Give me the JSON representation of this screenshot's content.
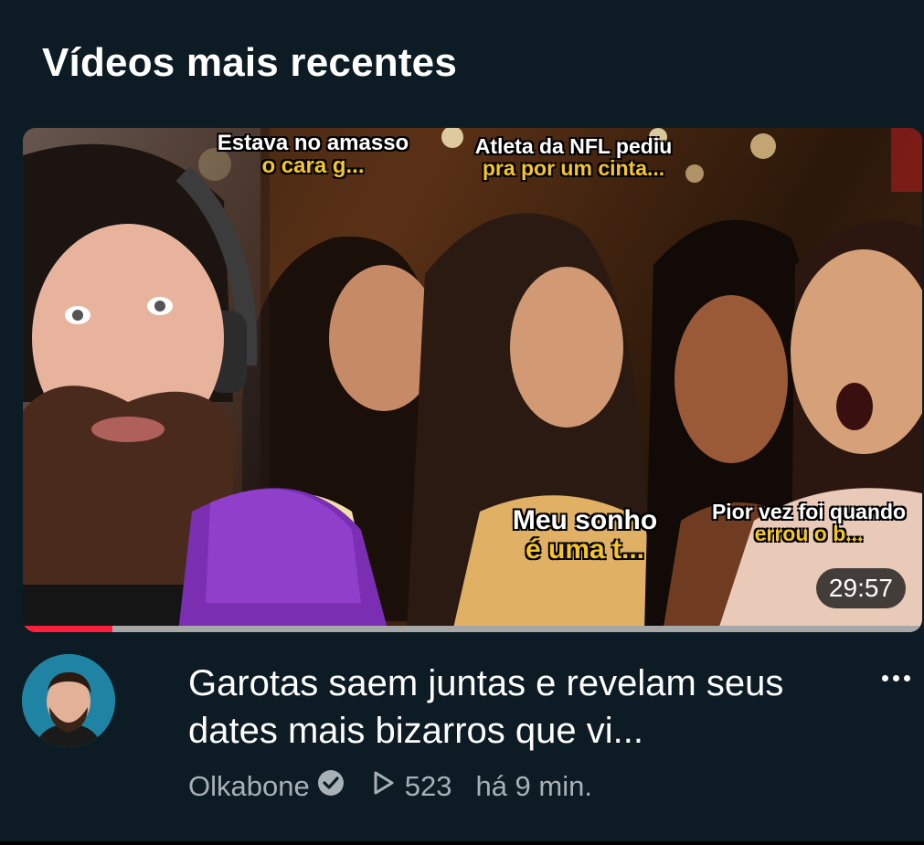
{
  "section": {
    "title": "Vídeos mais recentes"
  },
  "video": {
    "duration": "29:57",
    "progress_percent": 10,
    "thumbnail_captions": [
      {
        "line1": "Estava no amasso",
        "line2": "o cara  g..."
      },
      {
        "line1": "Atleta da NFL pediu",
        "line2": "pra por um cinta..."
      },
      {
        "line1": "Meu sonho",
        "line2": "é uma t..."
      },
      {
        "line1": "Pior vez foi quando",
        "line2": "errou o b..."
      }
    ],
    "title": "Garotas saem juntas e revelam seus dates mais bizarros que vi...",
    "channel": "Olkabone",
    "views": "523",
    "age": "há 9 min."
  },
  "icons": {
    "more": "more-vertical-icon",
    "verified": "verified-check-icon",
    "views": "play-outline-icon"
  },
  "colors": {
    "background": "#0c1b24",
    "progress": "#ff1f3d",
    "caption_yellow": "#f5c52a",
    "meta_text": "#a8b1b6"
  }
}
